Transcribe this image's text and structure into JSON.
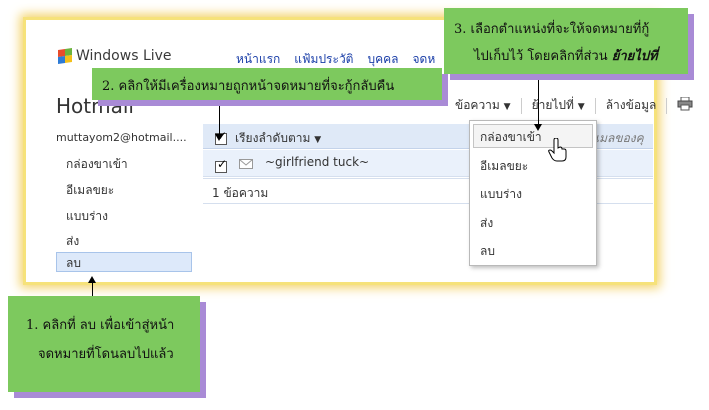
{
  "header": {
    "brand": "Windows Live",
    "nav": [
      "หน้าแรก",
      "แฟ้มประวัติ",
      "บุคคล",
      "จดห"
    ],
    "app_title": "Hotmail"
  },
  "toolbar": {
    "restore_partial": "ข้อความ",
    "move_to": "ย้ายไปที่",
    "clear": "ล้างข้อมูล"
  },
  "sidebar": {
    "account": "muttayom2@hotmail....",
    "items": [
      "กล่องขาเข้า",
      "อีเมลขยะ",
      "แบบร่าง",
      "ส่ง",
      "ลบ"
    ]
  },
  "message_list": {
    "sort_label": "เรียงลำดับตาม",
    "search_partial": "เมลของคุ",
    "rows": [
      {
        "sender": "~girlfriend tuck~"
      }
    ],
    "count_text": "1 ข้อความ"
  },
  "move_menu": {
    "items": [
      "กล่องขาเข้า",
      "อีเมลขยะ",
      "แบบร่าง",
      "ส่ง",
      "ลบ"
    ]
  },
  "callouts": {
    "one_line1": "1. คลิกที่ ลบ เพื่อเข้าสู่หน้า",
    "one_line2": "จดหมายที่โดนลบไปแล้ว",
    "two": "2. คลิกให้มีเครื่องหมายถูกหน้าจดหมายที่จะกู้กลับคืน",
    "three_line1": "3. เลือกตำแหน่งที่จะให้จดหมายที่กู้",
    "three_line2_prefix": "ไปเก็บไว้ โดยคลิกที่ส่วน",
    "three_line2_emph": "ย้ายไปที่"
  },
  "colors": {
    "callout_bg": "#7dc95e",
    "callout_shadow": "#a98bd6",
    "frame_glow": "#f3d36b",
    "link_blue": "#1a3ea8",
    "selection_blue": "#dde9fa"
  }
}
